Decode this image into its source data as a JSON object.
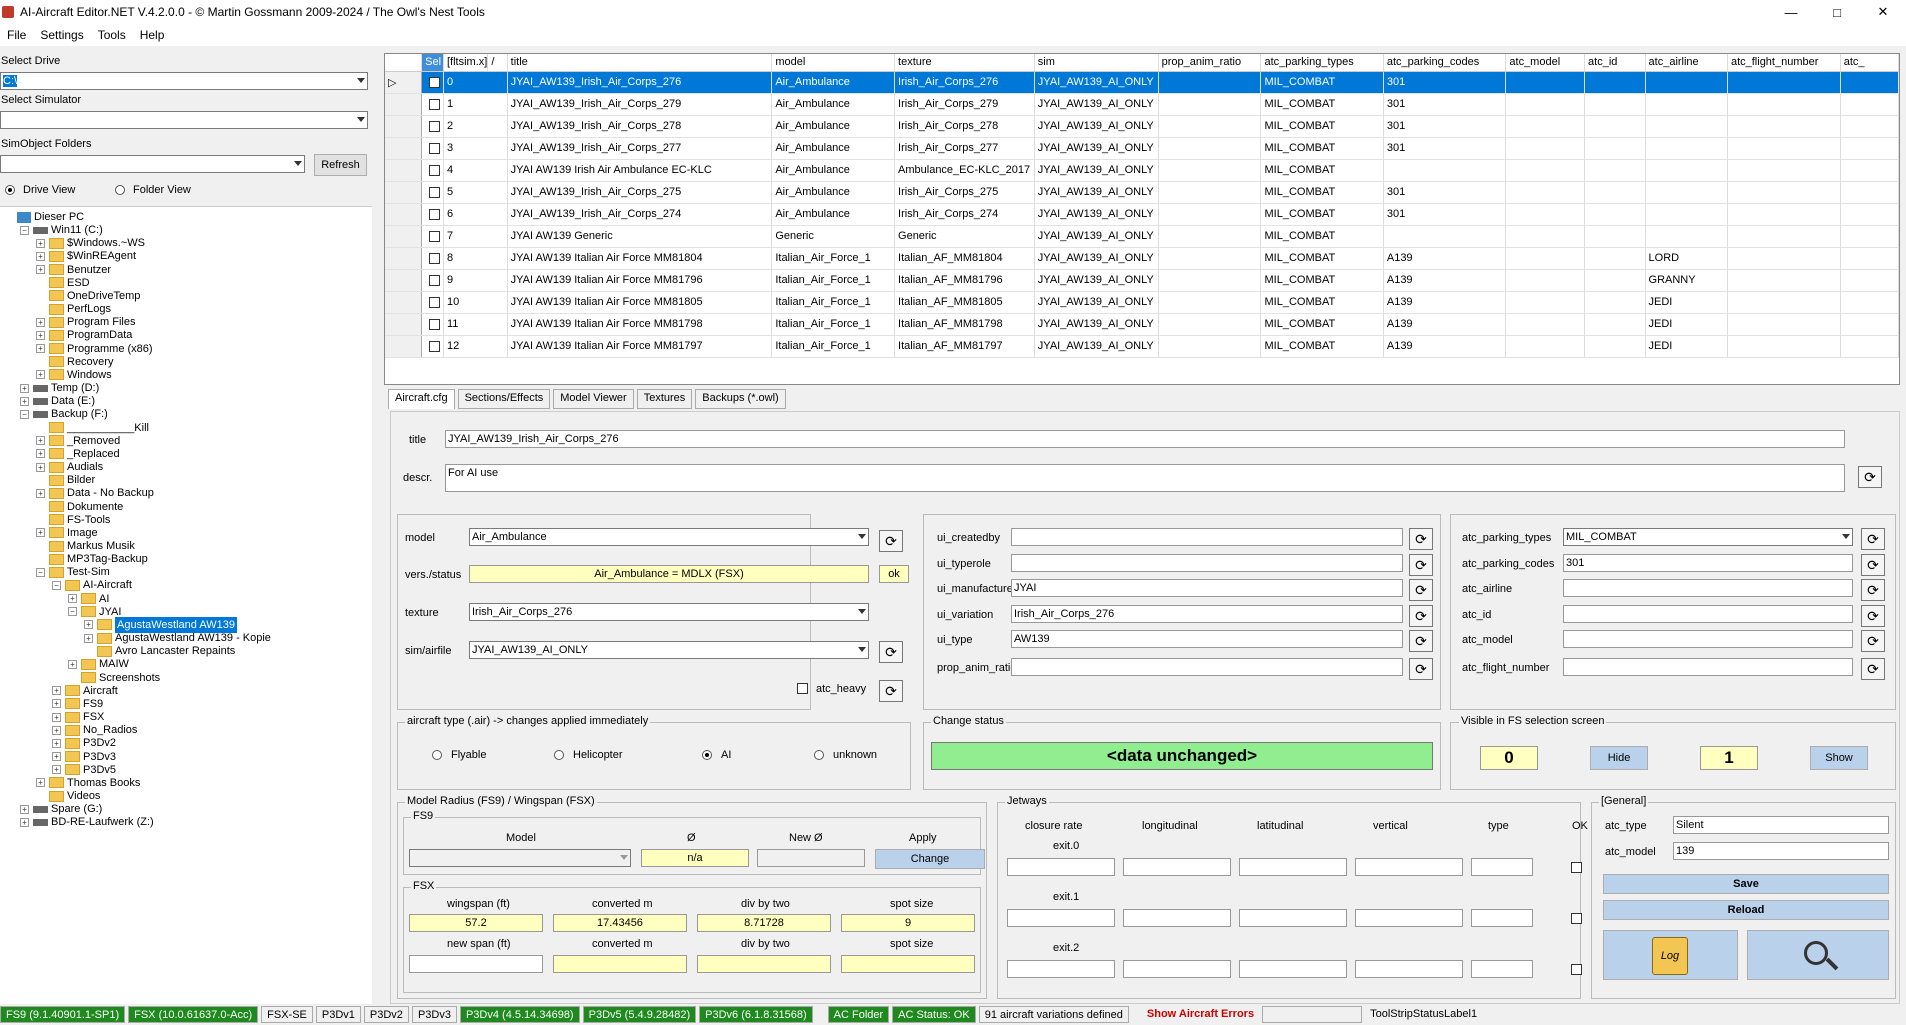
{
  "window": {
    "title": "AI-Aircraft Editor.NET V.4.2.0.0 -  © Martin Gossmann 2009-2024 / The Owl's Nest Tools",
    "min": "—",
    "max": "□",
    "close": "✕"
  },
  "menu": [
    "File",
    "Settings",
    "Tools",
    "Help"
  ],
  "left": {
    "drive_label": "Select Drive",
    "drive_value": "C:\\",
    "sim_label": "Select Simulator",
    "sim_value": "",
    "folder_label": "SimObject Folders",
    "folder_value": "",
    "refresh": "Refresh",
    "drive_view": "Drive View",
    "folder_view": "Folder View"
  },
  "tree": [
    "Dieser PC",
    "Win11 (C:)",
    "$Windows.~WS",
    "$WinREAgent",
    "Benutzer",
    "ESD",
    "OneDriveTemp",
    "PerfLogs",
    "Program Files",
    "ProgramData",
    "Programme (x86)",
    "Recovery",
    "Windows",
    "Temp (D:)",
    "Data (E:)",
    "Backup (F:)",
    "___________Kill",
    "_Removed",
    "_Replaced",
    "Audials",
    "Bilder",
    "Data - No Backup",
    "Dokumente",
    "FS-Tools",
    "Image",
    "Markus Musik",
    "MP3Tag-Backup",
    "Test-Sim",
    "AI-Aircraft",
    "AI",
    "JYAI",
    "AgustaWestland AW139",
    "AgustaWestland AW139 - Kopie",
    "Avro Lancaster Repaints",
    "MAIW",
    "Screenshots",
    "Aircraft",
    "FS9",
    "FSX",
    "No_Radios",
    "P3Dv2",
    "P3Dv3",
    "P3Dv5",
    "Thomas Books",
    "Videos",
    "Spare (G:)",
    "BD-RE-Laufwerk (Z:)"
  ],
  "grid": {
    "columns": [
      "Sel",
      "[fltsim.x]",
      "/",
      "title",
      "model",
      "texture",
      "sim",
      "prop_anim_ratio",
      "atc_parking_types",
      "atc_parking_codes",
      "atc_model",
      "atc_id",
      "atc_airline",
      "atc_flight_number",
      "atc_"
    ],
    "rows": [
      [
        "0",
        "JYAI_AW139_Irish_Air_Corps_276",
        "Air_Ambulance",
        "Irish_Air_Corps_276",
        "JYAI_AW139_AI_ONLY",
        "",
        "MIL_COMBAT",
        "301",
        "",
        "",
        "",
        ""
      ],
      [
        "1",
        "JYAI_AW139_Irish_Air_Corps_279",
        "Air_Ambulance",
        "Irish_Air_Corps_279",
        "JYAI_AW139_AI_ONLY",
        "",
        "MIL_COMBAT",
        "301",
        "",
        "",
        "",
        ""
      ],
      [
        "2",
        "JYAI_AW139_Irish_Air_Corps_278",
        "Air_Ambulance",
        "Irish_Air_Corps_278",
        "JYAI_AW139_AI_ONLY",
        "",
        "MIL_COMBAT",
        "301",
        "",
        "",
        "",
        ""
      ],
      [
        "3",
        "JYAI_AW139_Irish_Air_Corps_277",
        "Air_Ambulance",
        "Irish_Air_Corps_277",
        "JYAI_AW139_AI_ONLY",
        "",
        "MIL_COMBAT",
        "301",
        "",
        "",
        "",
        ""
      ],
      [
        "4",
        "JYAI AW139 Irish Air Ambulance EC-KLC",
        "Air_Ambulance",
        "Ambulance_EC-KLC_2017",
        "JYAI_AW139_AI_ONLY",
        "",
        "MIL_COMBAT",
        "",
        "",
        "",
        "",
        ""
      ],
      [
        "5",
        "JYAI_AW139_Irish_Air_Corps_275",
        "Air_Ambulance",
        "Irish_Air_Corps_275",
        "JYAI_AW139_AI_ONLY",
        "",
        "MIL_COMBAT",
        "301",
        "",
        "",
        "",
        ""
      ],
      [
        "6",
        "JYAI_AW139_Irish_Air_Corps_274",
        "Air_Ambulance",
        "Irish_Air_Corps_274",
        "JYAI_AW139_AI_ONLY",
        "",
        "MIL_COMBAT",
        "301",
        "",
        "",
        "",
        ""
      ],
      [
        "7",
        "JYAI AW139 Generic",
        "Generic",
        "Generic",
        "JYAI_AW139_AI_ONLY",
        "",
        "MIL_COMBAT",
        "",
        "",
        "",
        "",
        ""
      ],
      [
        "8",
        "JYAI AW139 Italian Air Force MM81804",
        "Italian_Air_Force_1",
        "Italian_AF_MM81804",
        "JYAI_AW139_AI_ONLY",
        "",
        "MIL_COMBAT",
        "A139",
        "",
        "",
        "LORD",
        ""
      ],
      [
        "9",
        "JYAI AW139 Italian Air Force MM81796",
        "Italian_Air_Force_1",
        "Italian_AF_MM81796",
        "JYAI_AW139_AI_ONLY",
        "",
        "MIL_COMBAT",
        "A139",
        "",
        "",
        "GRANNY",
        ""
      ],
      [
        "10",
        "JYAI AW139 Italian Air Force MM81805",
        "Italian_Air_Force_1",
        "Italian_AF_MM81805",
        "JYAI_AW139_AI_ONLY",
        "",
        "MIL_COMBAT",
        "A139",
        "",
        "",
        "JEDI",
        ""
      ],
      [
        "11",
        "JYAI AW139 Italian Air Force MM81798",
        "Italian_Air_Force_1",
        "Italian_AF_MM81798",
        "JYAI_AW139_AI_ONLY",
        "",
        "MIL_COMBAT",
        "A139",
        "",
        "",
        "JEDI",
        ""
      ],
      [
        "12",
        "JYAI AW139 Italian Air Force MM81797",
        "Italian_Air_Force_1",
        "Italian_AF_MM81797",
        "JYAI_AW139_AI_ONLY",
        "",
        "MIL_COMBAT",
        "A139",
        "",
        "",
        "JEDI",
        ""
      ]
    ]
  },
  "tabs": [
    "Aircraft.cfg",
    "Sections/Effects",
    "Model Viewer",
    "Textures",
    "Backups (*.owl)"
  ],
  "edit": {
    "title_label": "title",
    "title_value": "JYAI_AW139_Irish_Air_Corps_276",
    "descr_label": "descr.",
    "descr_value": "For AI use",
    "model_label": "model",
    "model_value": "Air_Ambulance",
    "vers_label": "vers./status",
    "vers_value": "Air_Ambulance = MDLX (FSX)",
    "ok": "ok",
    "texture_label": "texture",
    "texture_value": "Irish_Air_Corps_276",
    "sim_label": "sim/airfile",
    "sim_value": "JYAI_AW139_AI_ONLY",
    "atc_heavy": "atc_heavy",
    "ui_createdby": "ui_createdby",
    "ui_createdby_v": "",
    "ui_typerole": "ui_typerole",
    "ui_typerole_v": "",
    "ui_manufacturer": "ui_manufacturer",
    "ui_manufacturer_v": "JYAI",
    "ui_variation": "ui_variation",
    "ui_variation_v": "Irish_Air_Corps_276",
    "ui_type": "ui_type",
    "ui_type_v": "AW139",
    "prop_anim_ratio": "prop_anim_ratio",
    "prop_anim_ratio_v": "",
    "atc_parking_types": "atc_parking_types",
    "atc_parking_types_v": "MIL_COMBAT",
    "atc_parking_codes": "atc_parking_codes",
    "atc_parking_codes_v": "301",
    "atc_airline": "atc_airline",
    "atc_id": "atc_id",
    "atc_model": "atc_model",
    "atc_flight_number": "atc_flight_number",
    "aircraft_type": "aircraft type (.air)  ->  changes applied immediately",
    "types": [
      "Flyable",
      "Helicopter",
      "AI",
      "unknown"
    ],
    "change_status": "Change status",
    "status_value": "<data unchanged>",
    "visible": "Visible in FS selection screen",
    "vis_count0": "0",
    "hide": "Hide",
    "vis_count1": "1",
    "show": "Show",
    "radius": "Model Radius (FS9) / Wingspan (FSX)",
    "fs9": "FS9",
    "fs9_model": "Model",
    "fs9_dia": "Ø",
    "fs9_new": "New Ø",
    "fs9_apply": "Apply",
    "fs9_dia_v": "n/a",
    "change": "Change",
    "fsx": "FSX",
    "wingspan": "wingspan (ft)",
    "converted": "converted m",
    "divtwo": "div by two",
    "spot": "spot size",
    "wingspan_v": "57.2",
    "converted_v": "17.43456",
    "divtwo_v": "8.71728",
    "spot_v": "9",
    "newspan": "new span (ft)",
    "jetways": "Jetways",
    "jw_cols": [
      "closure rate",
      "longitudinal",
      "latitudinal",
      "vertical",
      "type",
      "OK"
    ],
    "exits": [
      "exit.0",
      "exit.1",
      "exit.2"
    ],
    "general": "[General]",
    "atc_type": "atc_type",
    "atc_type_v": "Silent",
    "atc_model_g": "atc_model",
    "atc_model_v": "139",
    "save": "Save",
    "reload": "Reload",
    "log": "Log"
  },
  "status": [
    {
      "t": "FS9 (9.1.40901.1-SP1)",
      "g": true
    },
    {
      "t": "FSX (10.0.61637.0-Acc)",
      "g": true
    },
    {
      "t": "FSX-SE",
      "g": false
    },
    {
      "t": "P3Dv1",
      "g": false
    },
    {
      "t": "P3Dv2",
      "g": false
    },
    {
      "t": "P3Dv3",
      "g": false
    },
    {
      "t": "P3Dv4 (4.5.14.34698)",
      "g": true
    },
    {
      "t": "P3Dv5 (5.4.9.28482)",
      "g": true
    },
    {
      "t": "P3Dv6 (6.1.8.31568)",
      "g": true
    }
  ],
  "status2": {
    "acfolder": "AC Folder",
    "acstatus": "AC Status: OK",
    "count": "91 aircraft variations defined",
    "errors": "Show Aircraft Errors",
    "label1": "ToolStripStatusLabel1"
  }
}
